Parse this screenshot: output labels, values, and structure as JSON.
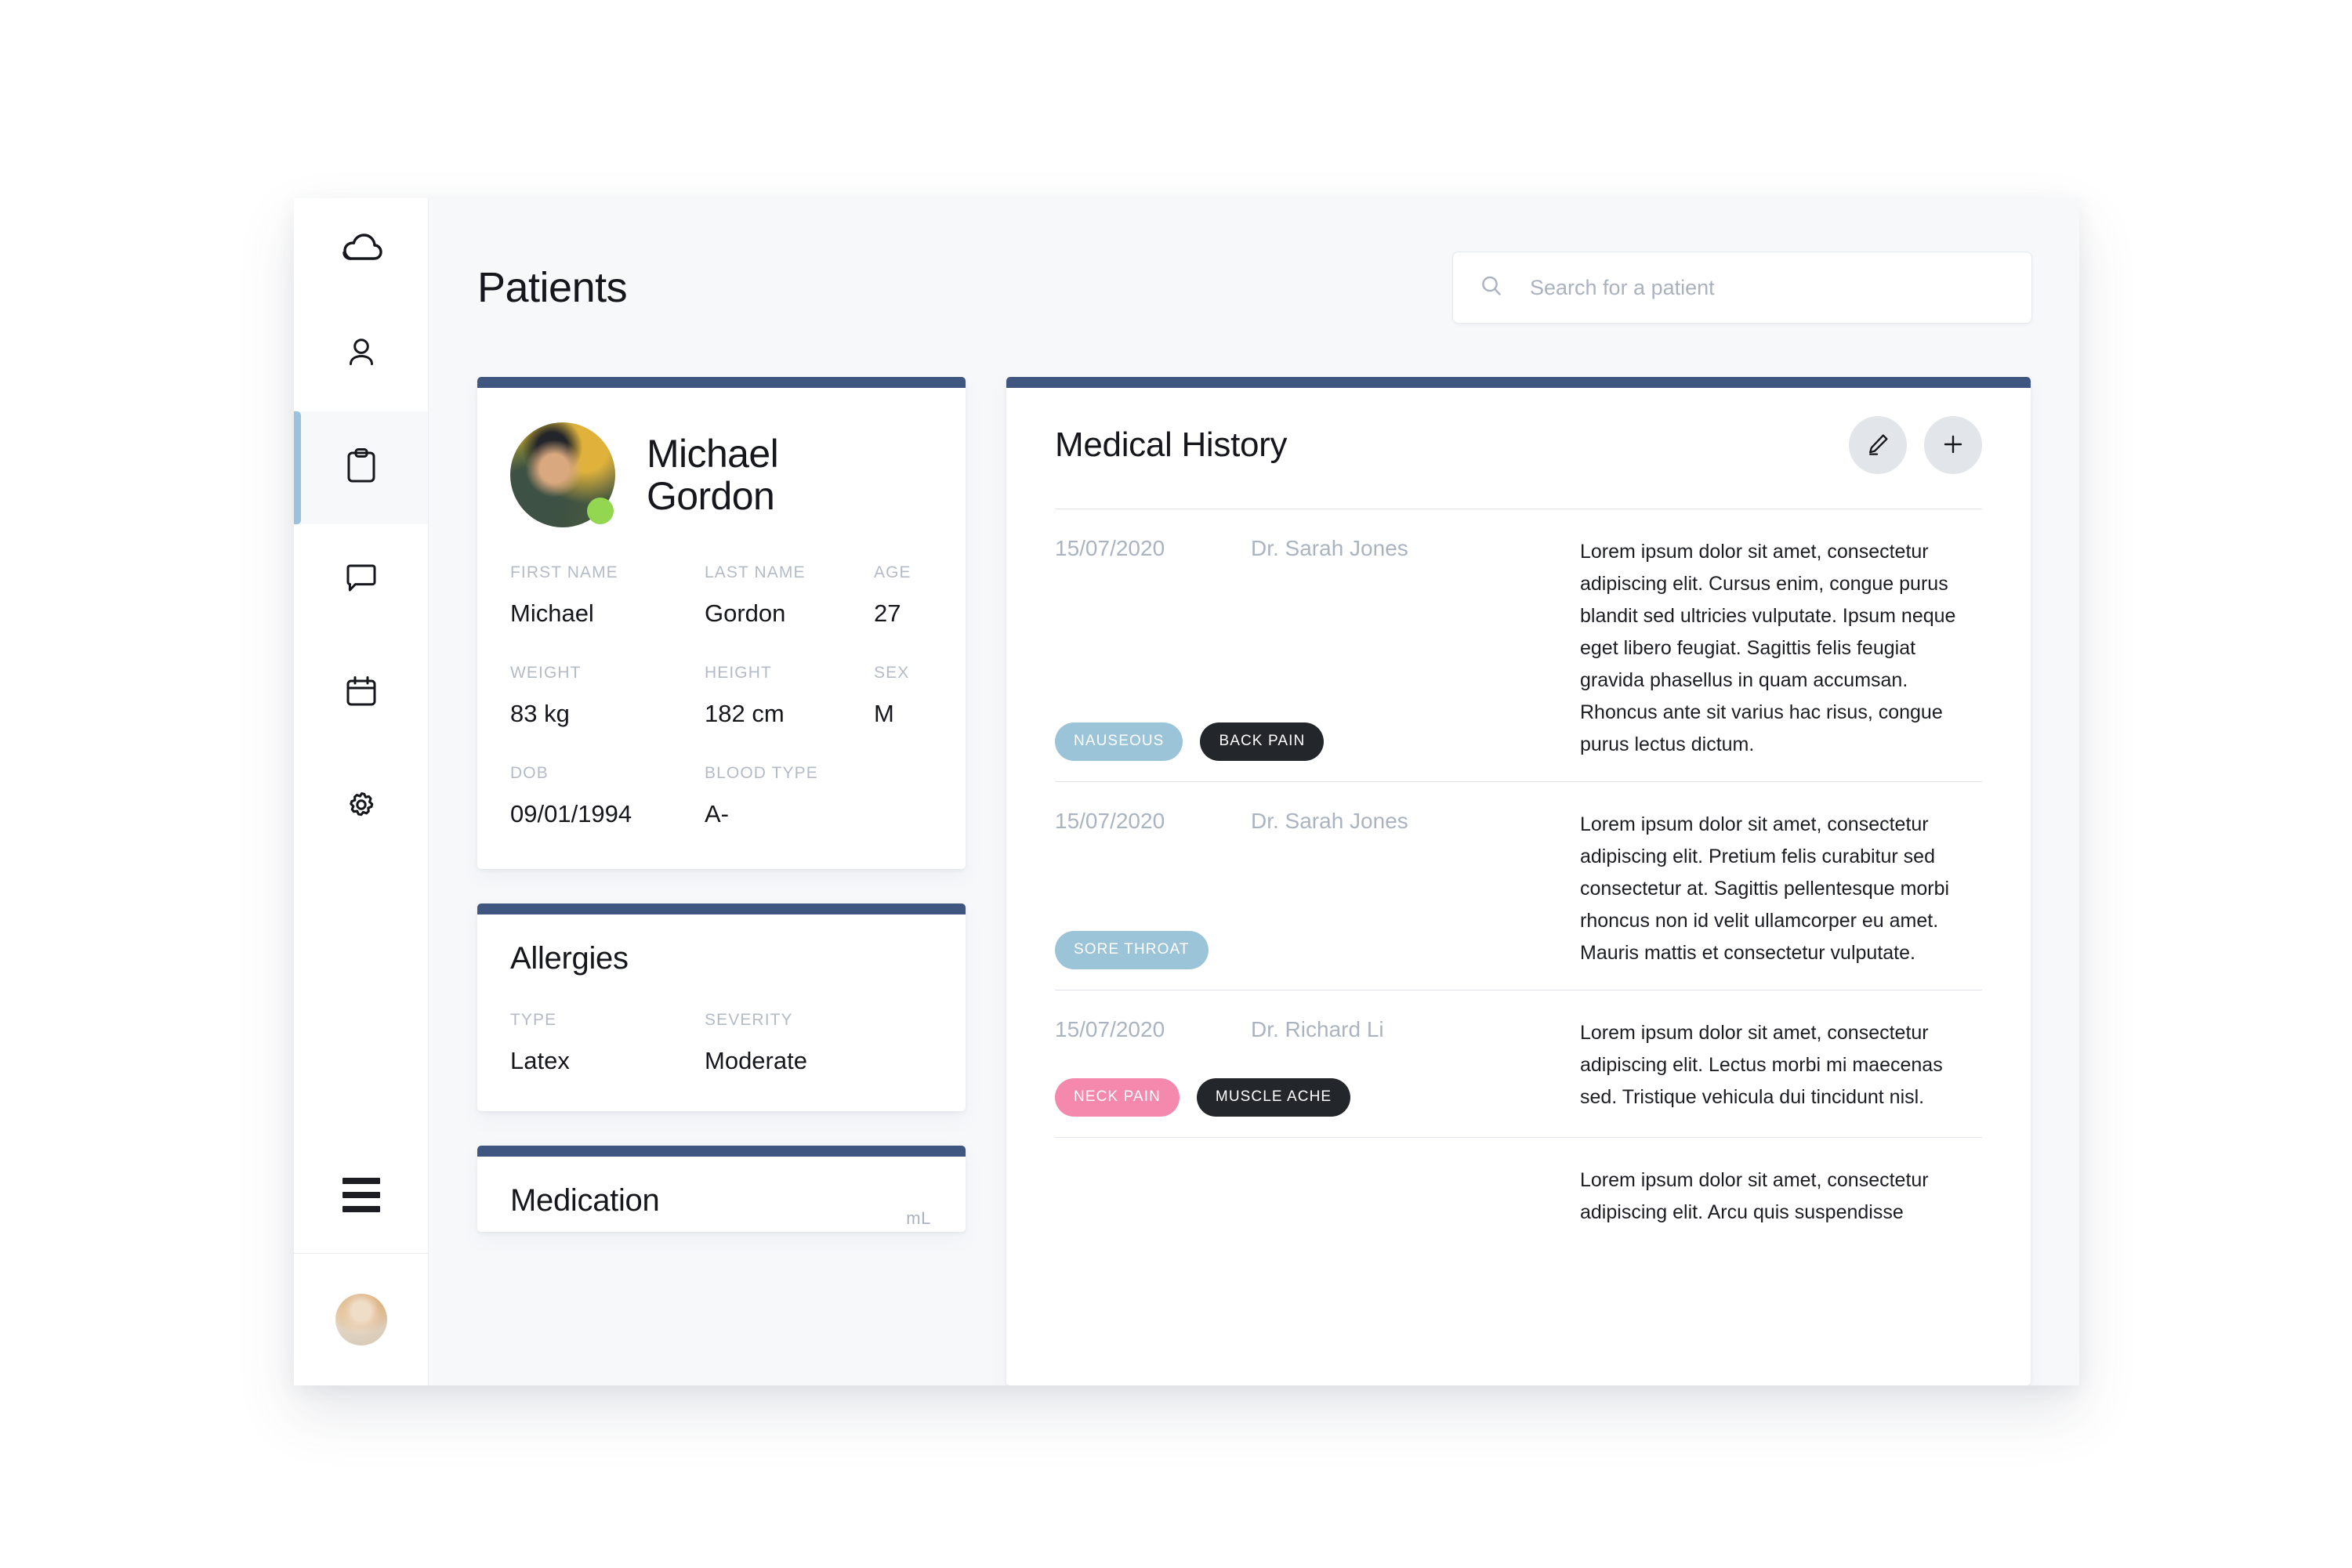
{
  "app": {
    "logo_icon": "cloud-icon"
  },
  "sidebar": {
    "items": [
      {
        "icon": "person-icon",
        "name": "patients-profile",
        "active": false
      },
      {
        "icon": "clipboard-icon",
        "name": "records",
        "active": true
      },
      {
        "icon": "chat-icon",
        "name": "messages",
        "active": false
      },
      {
        "icon": "calendar-icon",
        "name": "appointments",
        "active": false
      },
      {
        "icon": "gear-icon",
        "name": "settings",
        "active": false
      }
    ],
    "menu_icon": "hamburger-menu-icon",
    "user_avatar_icon": "user-avatar"
  },
  "header": {
    "title": "Patients"
  },
  "search": {
    "icon": "search-icon",
    "placeholder": "Search for a patient",
    "value": ""
  },
  "patient": {
    "avatar_icon": "patient-avatar-photo",
    "status": "online",
    "name_line1": "Michael",
    "name_line2": "Gordon",
    "fields": [
      {
        "label": "FIRST NAME",
        "value": "Michael"
      },
      {
        "label": "LAST NAME",
        "value": "Gordon"
      },
      {
        "label": "AGE",
        "value": "27"
      },
      {
        "label": "WEIGHT",
        "value": "83 kg"
      },
      {
        "label": "HEIGHT",
        "value": "182 cm"
      },
      {
        "label": "SEX",
        "value": "M"
      },
      {
        "label": "DOB",
        "value": "09/01/1994"
      },
      {
        "label": "BLOOD TYPE",
        "value": "A-"
      }
    ]
  },
  "allergies": {
    "title": "Allergies",
    "col_type_label": "TYPE",
    "col_severity_label": "SEVERITY",
    "rows": [
      {
        "type": "Latex",
        "severity": "Moderate"
      }
    ]
  },
  "medication": {
    "title": "Medication",
    "unit_label": "mL"
  },
  "history": {
    "title": "Medical History",
    "edit_icon": "pencil-icon",
    "add_icon": "plus-icon",
    "entries": [
      {
        "date": "15/07/2020",
        "doctor": "Dr. Sarah Jones",
        "text": "Lorem ipsum dolor sit amet, consectetur adipiscing elit. Cursus enim, congue purus blandit sed ultricies vulputate. Ipsum neque eget libero feugiat. Sagittis felis feugiat gravida phasellus in quam accumsan. Rhoncus ante sit varius hac risus, congue purus lectus dictum.",
        "tags": [
          {
            "label": "NAUSEOUS",
            "color": "blue"
          },
          {
            "label": "BACK PAIN",
            "color": "dark"
          }
        ]
      },
      {
        "date": "15/07/2020",
        "doctor": "Dr. Sarah Jones",
        "text": "Lorem ipsum dolor sit amet, consectetur adipiscing elit. Pretium felis curabitur sed consectetur at. Sagittis pellentesque morbi rhoncus non id velit ullamcorper eu amet. Mauris mattis et consectetur vulputate.",
        "tags": [
          {
            "label": "SORE THROAT",
            "color": "blue"
          }
        ]
      },
      {
        "date": "15/07/2020",
        "doctor": "Dr. Richard Li",
        "text": "Lorem ipsum dolor sit amet, consectetur adipiscing elit. Lectus morbi mi maecenas sed. Tristique vehicula dui tincidunt nisl.",
        "tags": [
          {
            "label": "NECK PAIN",
            "color": "pink"
          },
          {
            "label": "MUSCLE ACHE",
            "color": "dark"
          }
        ]
      },
      {
        "date": "",
        "doctor": "",
        "text": "Lorem ipsum dolor sit amet, consectetur adipiscing elit. Arcu quis suspendisse",
        "tags": []
      }
    ]
  },
  "colors": {
    "card_accent": "#3e5680",
    "sidebar_active": "#9bc2dc",
    "tag_blue": "#9bc4d8",
    "tag_dark": "#23262b",
    "tag_pink": "#f589ad",
    "status_online": "#93d650",
    "page_bg": "#f7f8fa"
  }
}
